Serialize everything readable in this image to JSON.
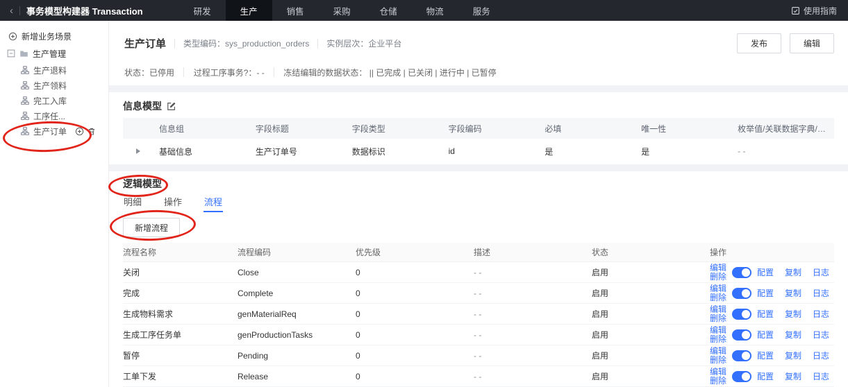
{
  "topbar": {
    "back_icon": "‹",
    "title": "事务模型构建器 Transaction",
    "tabs": [
      "研发",
      "生产",
      "销售",
      "采购",
      "仓储",
      "物流",
      "服务"
    ],
    "guide_label": "使用指南"
  },
  "sidebar": {
    "add_scenario": "新增业务场景",
    "group_label": "生产管理",
    "items": [
      "生产退料",
      "生产领料",
      "完工入库",
      "工序任...",
      "生产订单"
    ]
  },
  "header": {
    "title": "生产订单",
    "type_code": "类型编码：sys_production_orders",
    "instance_level": "实例层次：企业平台",
    "publish_label": "发布",
    "edit_label": "编辑",
    "status_items": [
      "状态：已停用",
      "过程工序事务?：- -",
      "冻结编辑的数据状态： || 已完成 | 已关闭 | 进行中 | 已暂停"
    ]
  },
  "info_model": {
    "title": "信息模型",
    "headers": [
      "信息组",
      "字段标题",
      "字段类型",
      "字段编码",
      "必填",
      "唯一性",
      "枚举值/关联数据字典/模型"
    ],
    "row": {
      "group": "基础信息",
      "field_title": "生产订单号",
      "field_type": "数据标识",
      "field_code": "id",
      "required": "是",
      "unique": "是",
      "enum_value": "- -"
    }
  },
  "logic_model": {
    "title": "逻辑模型",
    "tabs": [
      "明细",
      "操作",
      "流程"
    ],
    "add_button": "新增流程",
    "headers": [
      "流程名称",
      "流程编码",
      "优先级",
      "描述",
      "状态",
      "操作"
    ],
    "ops_labels": {
      "edit": "编辑",
      "delete": "删除",
      "config": "配置",
      "copy": "复制",
      "log": "日志"
    },
    "rows": [
      {
        "name": "关闭",
        "code": "Close",
        "priority": "0",
        "desc": "- -",
        "status": "启用",
        "enabled": true
      },
      {
        "name": "完成",
        "code": "Complete",
        "priority": "0",
        "desc": "- -",
        "status": "启用",
        "enabled": true
      },
      {
        "name": "生成物料需求",
        "code": "genMaterialReq",
        "priority": "0",
        "desc": "- -",
        "status": "启用",
        "enabled": true
      },
      {
        "name": "生成工序任务单",
        "code": "genProductionTasks",
        "priority": "0",
        "desc": "- -",
        "status": "启用",
        "enabled": true
      },
      {
        "name": "暂停",
        "code": "Pending",
        "priority": "0",
        "desc": "- -",
        "status": "启用",
        "enabled": true
      },
      {
        "name": "工单下发",
        "code": "Release",
        "priority": "0",
        "desc": "- -",
        "status": "启用",
        "enabled": true
      }
    ]
  },
  "colors": {
    "accent": "#3370ff",
    "annotation_red": "#e1251b",
    "topbar_bg": "#24282e"
  }
}
